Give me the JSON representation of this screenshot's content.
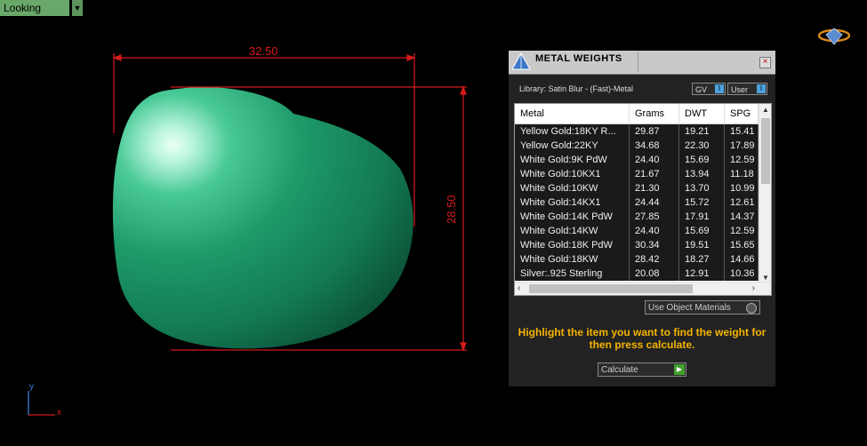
{
  "viewport": {
    "view_label": "Looking Down",
    "dim_width": "32.50",
    "dim_height": "28.50",
    "axis_y": "y",
    "axis_x": "x",
    "object_color": "#1f9a6a",
    "dimension_color": "#d71a1a"
  },
  "panel": {
    "title": "METAL WEIGHTS",
    "close_label": "×",
    "library_label": "Library: Satin Blur - (Fast)-Metal",
    "gv_label": "GV",
    "user_label": "User",
    "columns": [
      "Metal",
      "Grams",
      "DWT",
      "SPG"
    ],
    "rows": [
      [
        "Yellow Gold:18KY R...",
        "29.87",
        "19.21",
        "15.41"
      ],
      [
        "Yellow Gold:22KY",
        "34.68",
        "22.30",
        "17.89"
      ],
      [
        "White Gold:9K PdW",
        "24.40",
        "15.69",
        "12.59"
      ],
      [
        "White Gold:10KX1",
        "21.67",
        "13.94",
        "11.18"
      ],
      [
        "White Gold:10KW",
        "21.30",
        "13.70",
        "10.99"
      ],
      [
        "White Gold:14KX1",
        "24.44",
        "15.72",
        "12.61"
      ],
      [
        "White Gold:14K PdW",
        "27.85",
        "17.91",
        "14.37"
      ],
      [
        "White Gold:14KW",
        "24.40",
        "15.69",
        "12.59"
      ],
      [
        "White Gold:18K PdW",
        "30.34",
        "19.51",
        "15.65"
      ],
      [
        "White Gold:18KW",
        "28.42",
        "18.27",
        "14.66"
      ],
      [
        "Silver:.925 Sterling",
        "20.08",
        "12.91",
        "10.36"
      ]
    ],
    "use_object_materials": "Use Object Materials",
    "hint": "Highlight the item you want to find the weight for then press calculate.",
    "calculate_label": "Calculate"
  }
}
